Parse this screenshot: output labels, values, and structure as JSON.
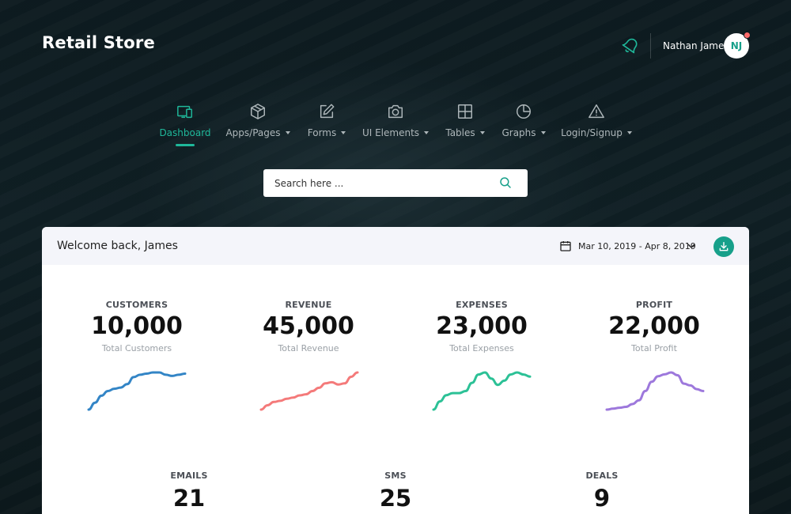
{
  "app": {
    "title": "Retail Store"
  },
  "user": {
    "name": "Nathan James",
    "initials": "NJ"
  },
  "nav": {
    "items": [
      {
        "label": "Dashboard",
        "icon": "devices-icon",
        "active": true,
        "dropdown": false
      },
      {
        "label": "Apps/Pages",
        "icon": "box-icon",
        "active": false,
        "dropdown": true
      },
      {
        "label": "Forms",
        "icon": "edit-icon",
        "active": false,
        "dropdown": true
      },
      {
        "label": "UI Elements",
        "icon": "camera-icon",
        "active": false,
        "dropdown": true
      },
      {
        "label": "Tables",
        "icon": "grid-icon",
        "active": false,
        "dropdown": true
      },
      {
        "label": "Graphs",
        "icon": "pie-chart-icon",
        "active": false,
        "dropdown": true
      },
      {
        "label": "Login/Signup",
        "icon": "warning-icon",
        "active": false,
        "dropdown": true
      }
    ]
  },
  "search": {
    "placeholder": "Search here ..."
  },
  "card": {
    "welcome": "Welcome back, James",
    "date_range": "Mar 10, 2019 - Apr 8, 2019"
  },
  "stats": [
    {
      "label": "CUSTOMERS",
      "value": "10,000",
      "sub": "Total Customers",
      "color": "#3385c6",
      "trend": [
        0,
        3,
        6,
        8,
        9,
        9.5,
        11,
        14,
        15,
        15.5,
        16,
        16,
        15,
        14.5,
        15,
        15.5
      ]
    },
    {
      "label": "REVENUE",
      "value": "45,000",
      "sub": "Total Revenue",
      "color": "#f47a7a",
      "trend": [
        0,
        2,
        3.5,
        4,
        5,
        5.5,
        6.5,
        7,
        8.5,
        10,
        12,
        12.5,
        11.5,
        12,
        15,
        17
      ]
    },
    {
      "label": "EXPENSES",
      "value": "23,000",
      "sub": "Total Expenses",
      "color": "#2cc196",
      "trend": [
        0,
        4,
        7,
        8,
        8,
        9,
        13,
        17,
        18,
        15,
        12,
        14,
        17,
        18,
        17,
        16
      ]
    },
    {
      "label": "PROFIT",
      "value": "22,000",
      "sub": "Total Profit",
      "color": "#9d78dc",
      "trend": [
        0,
        0.5,
        1,
        1.5,
        3,
        5,
        10,
        15,
        18,
        19,
        20,
        18.5,
        14,
        13,
        11,
        10
      ]
    }
  ],
  "small_stats": [
    {
      "label": "EMAILS",
      "value": "21"
    },
    {
      "label": "SMS",
      "value": "25"
    },
    {
      "label": "DEALS",
      "value": "9"
    }
  ],
  "colors": {
    "accent": "#1fb89a",
    "button": "#17a08a",
    "notification": "#ff6b6b"
  }
}
